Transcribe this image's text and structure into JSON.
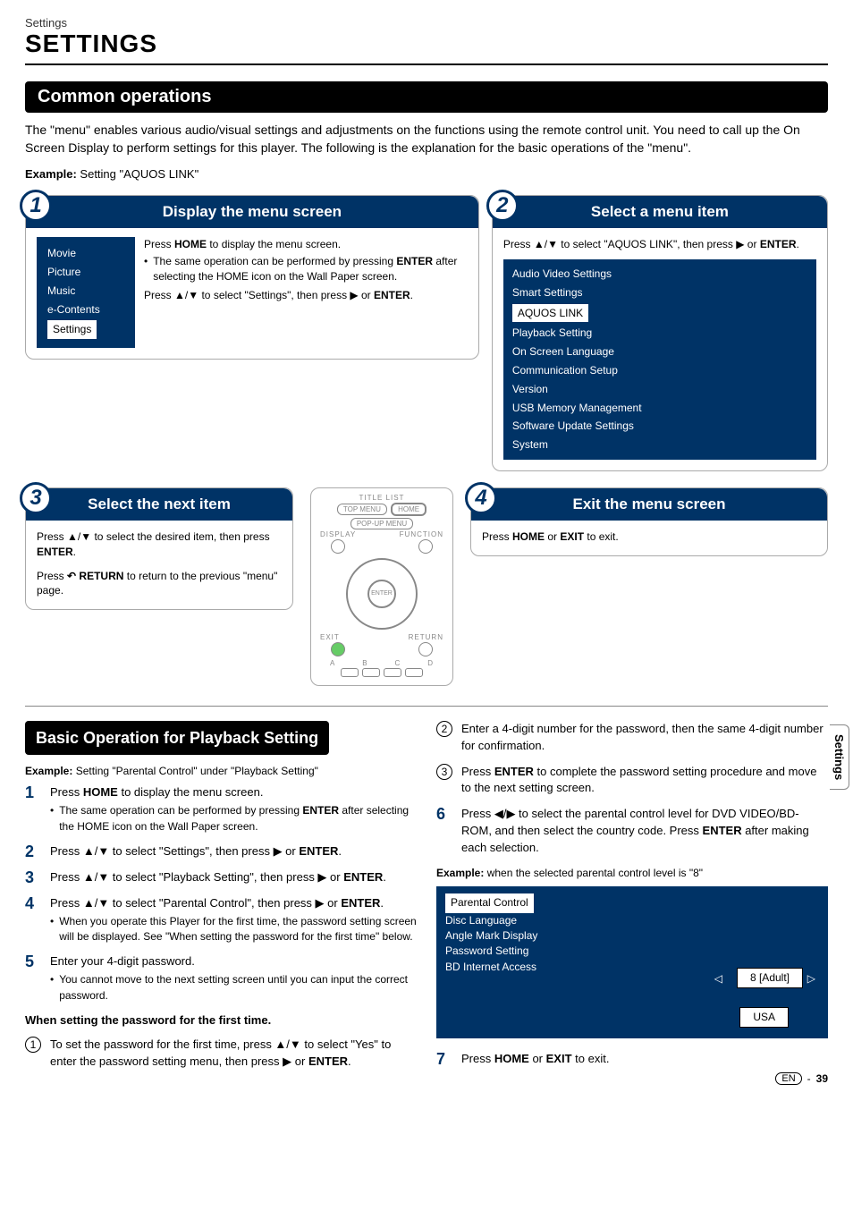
{
  "breadcrumb": "Settings",
  "page_title": "SETTINGS",
  "section1_title": "Common operations",
  "intro": "The \"menu\" enables various audio/visual settings and adjustments on the functions using the remote control unit. You need to call up the On Screen Display to perform settings for this player. The following is the explanation for the basic operations of the \"menu\".",
  "example1_label": "Example:",
  "example1_text": " Setting \"AQUOS LINK\"",
  "step1": {
    "num": "1",
    "title": "Display the menu screen",
    "menu": [
      "Movie",
      "Picture",
      "Music",
      "e-Contents"
    ],
    "menu_selected": "Settings",
    "text_part1": "Press ",
    "home": "HOME",
    "text_part2": " to display the menu screen.",
    "bullet_a": "The same operation can be performed by pressing ",
    "bullet_b": "ENTER",
    "bullet_c": " after selecting the HOME icon on the Wall Paper screen.",
    "text2a": "Press ",
    "text2b": " to select \"Settings\", then press ",
    "text2c": " or ",
    "text2d": "ENTER",
    "text2e": "."
  },
  "step2": {
    "num": "2",
    "title": "Select a menu item",
    "text_a": "Press ",
    "text_b": " to select \"AQUOS LINK\", then press ",
    "text_c": " or ",
    "text_d": "ENTER",
    "text_e": ".",
    "menu_top": [
      "Audio Video Settings",
      "Smart Settings"
    ],
    "menu_selected": "AQUOS LINK",
    "menu_rest": [
      "Playback Setting",
      "On Screen Language",
      "Communication Setup",
      "Version",
      "USB Memory Management",
      "Software Update Settings",
      "System"
    ]
  },
  "step3": {
    "num": "3",
    "title": "Select the next item",
    "p1a": "Press ",
    "p1b": " to select the desired item, then press ",
    "p1c": "ENTER",
    "p1d": ".",
    "p2a": "Press ",
    "p2b": " RETURN",
    "p2c": " to return to the previous \"menu\" page."
  },
  "step4": {
    "num": "4",
    "title": "Exit the menu screen",
    "text_a": "Press ",
    "text_b": "HOME",
    "text_c": " or ",
    "text_d": "EXIT",
    "text_e": " to exit."
  },
  "remote": {
    "title_list": "TITLE LIST",
    "top_menu": "TOP MENU",
    "home": "HOME",
    "popup": "POP-UP MENU",
    "display": "DISPLAY",
    "function": "FUNCTION",
    "enter": "ENTER",
    "exit": "EXIT",
    "return": "RETURN",
    "a": "A",
    "b": "B",
    "c": "C",
    "d": "D"
  },
  "section2_title": "Basic Operation for Playback Setting",
  "example2_label": "Example:",
  "example2_text": " Setting \"Parental Control\" under \"Playback Setting\"",
  "steps_left": [
    {
      "n": "1",
      "t": "Press <b>HOME</b> to display the menu screen.",
      "sub": [
        "The same operation can be performed by pressing <b>ENTER</b> after selecting the HOME icon on the Wall Paper screen."
      ]
    },
    {
      "n": "2",
      "t": "Press ▲/▼ to select \"Settings\", then press ▶ or <b>ENTER</b>."
    },
    {
      "n": "3",
      "t": "Press ▲/▼ to select \"Playback Setting\", then press ▶ or <b>ENTER</b>."
    },
    {
      "n": "4",
      "t": "Press ▲/▼ to select \"Parental Control\", then press ▶ or <b>ENTER</b>.",
      "sub": [
        "When you operate this Player for the first time, the password setting screen will be displayed. See \"When setting the password for the first time\" below."
      ]
    },
    {
      "n": "5",
      "t": "Enter your 4-digit password.",
      "sub": [
        "You cannot move to the next setting screen until you can input the correct password."
      ]
    }
  ],
  "sub_heading": "When setting the password for the first time.",
  "circ_left": [
    {
      "n": "1",
      "t": "To set the password for the first time, press ▲/▼ to select \"Yes\" to enter the password setting menu, then press ▶ or <b>ENTER</b>."
    }
  ],
  "circ_right": [
    {
      "n": "2",
      "t": "Enter a 4-digit number for the password, then the same 4-digit number for confirmation."
    },
    {
      "n": "3",
      "t": "Press <b>ENTER</b> to complete the password setting procedure and move to the next setting screen."
    }
  ],
  "steps_right": [
    {
      "n": "6",
      "t": "Press ◀/▶ to select the parental control level for DVD VIDEO/BD-ROM, and then select the country code. Press <b>ENTER</b> after making each selection."
    }
  ],
  "example3_label": "Example:",
  "example3_text": " when the selected parental control level is \"8\"",
  "playback_menu": {
    "selected": "Parental Control",
    "items": [
      "Disc Language",
      "Angle Mark Display",
      "Password Setting",
      "BD Internet Access"
    ],
    "value1": "8 [Adult]",
    "value2": "USA"
  },
  "step7": {
    "n": "7",
    "t": "Press <b>HOME</b> or <b>EXIT</b> to exit."
  },
  "side_tab": "Settings",
  "footer_lang": "EN",
  "footer_sep": "-",
  "footer_page": "39"
}
